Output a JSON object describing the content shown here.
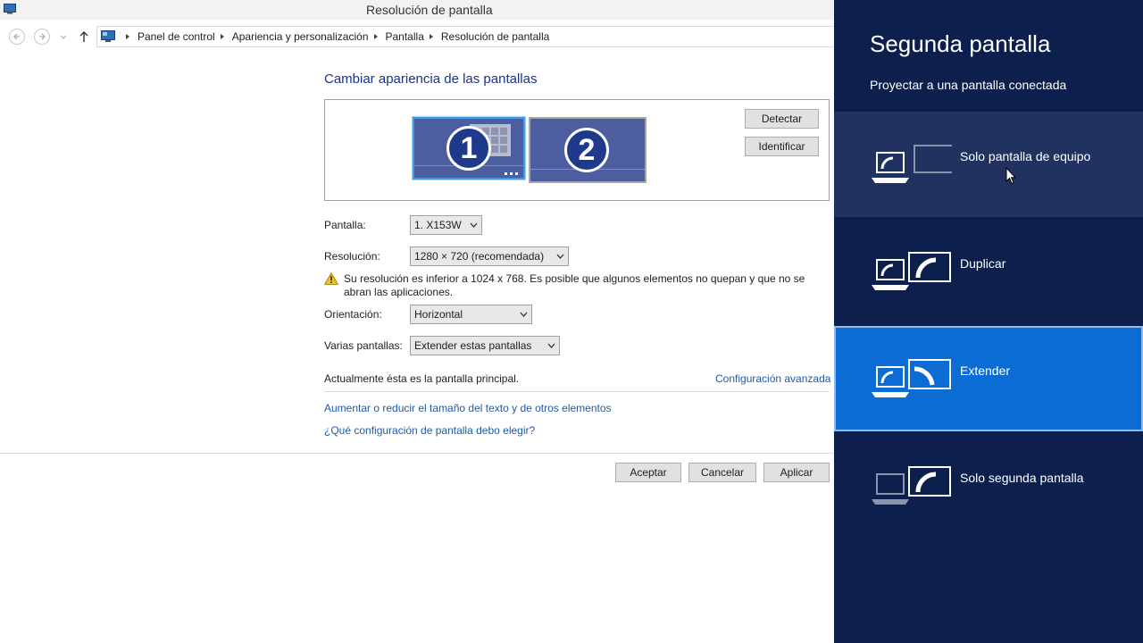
{
  "window": {
    "title": "Resolución de pantalla"
  },
  "address": {
    "crumbs": [
      "Panel de control",
      "Apariencia y personalización",
      "Pantalla",
      "Resolución de pantalla"
    ]
  },
  "content": {
    "heading": "Cambiar apariencia de las pantallas",
    "monitors": [
      {
        "number": "1"
      },
      {
        "number": "2"
      }
    ],
    "detect_label": "Detectar",
    "identify_label": "Identificar",
    "pantalla_label": "Pantalla:",
    "pantalla_value": "1. X153W",
    "resolution_label": "Resolución:",
    "resolution_value": "1280 × 720 (recomendada)",
    "warning_text": "Su resolución es inferior a 1024 x 768. Es posible que algunos elementos no quepan y que no se abran las aplicaciones.",
    "orientation_label": "Orientación:",
    "orientation_value": "Horizontal",
    "multi_label": "Varias pantallas:",
    "multi_value": "Extender estas pantallas",
    "main_display_text": "Actualmente ésta es la pantalla principal.",
    "advanced_link": "Configuración avanzada",
    "text_size_link": "Aumentar o reducir el tamaño del texto y de otros elementos",
    "which_link": "¿Qué configuración de pantalla debo elegir?",
    "ok_label": "Aceptar",
    "cancel_label": "Cancelar",
    "apply_label": "Aplicar"
  },
  "panel": {
    "title": "Segunda pantalla",
    "subtitle": "Proyectar a una pantalla conectada",
    "options": [
      {
        "label": "Solo pantalla de equipo",
        "icon": "pc-screen-only-icon",
        "state": "hover"
      },
      {
        "label": "Duplicar",
        "icon": "duplicate-icon",
        "state": "normal"
      },
      {
        "label": "Extender",
        "icon": "extend-icon",
        "state": "selected"
      },
      {
        "label": "Solo segunda pantalla",
        "icon": "second-screen-only-icon",
        "state": "normal"
      }
    ]
  },
  "colors": {
    "panel_bg": "#0c1f4d",
    "hover_bg": "#213261",
    "selected_bg": "#0b6cd6",
    "link": "#1e5aa8",
    "heading": "#1e3287"
  }
}
